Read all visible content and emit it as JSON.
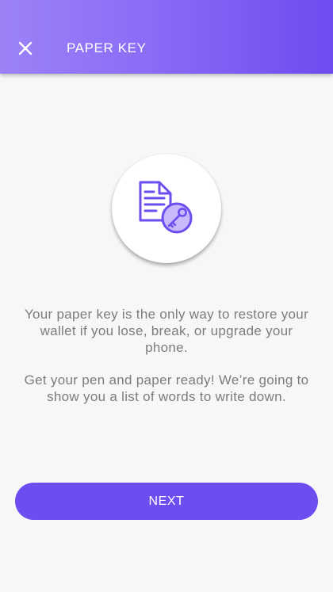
{
  "header": {
    "title": "PAPER KEY",
    "close_icon": "close-icon"
  },
  "hero": {
    "icon": "paper-key-icon",
    "accent_color": "#6d4df0"
  },
  "content": {
    "paragraph_1": "Your paper key is the only way to restore your wallet if you lose, break, or upgrade your phone.",
    "paragraph_2": "Get your pen and paper ready! We’re going to show you a list of words to write down."
  },
  "actions": {
    "next_label": "NEXT"
  },
  "colors": {
    "header_gradient_start": "#9c82f7",
    "header_gradient_end": "#6e4bf0",
    "primary": "#6d4df0",
    "background": "#f7f7f7",
    "body_text": "#7c7c7c"
  }
}
